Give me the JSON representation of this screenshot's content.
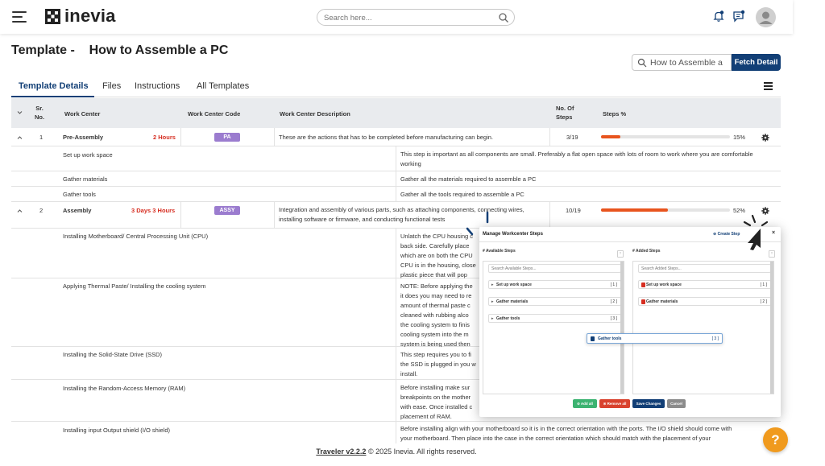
{
  "nav": {
    "brand": "inevia",
    "search_placeholder": "Search here..."
  },
  "header": {
    "title_prefix": "Template -",
    "title_name": "How to Assemble a PC",
    "template_search_value": "How to Assemble a",
    "fetch_label": "Fetch Detail"
  },
  "tabs": [
    {
      "label": "Template Details",
      "active": true
    },
    {
      "label": "Files",
      "active": false
    },
    {
      "label": "Instructions",
      "active": false
    },
    {
      "label": "All Templates",
      "active": false
    }
  ],
  "table": {
    "columns": {
      "sr": "Sr. No.",
      "center": "Work Center",
      "code": "Work Center Code",
      "desc": "Work Center Description",
      "steps_no": "No. Of Steps",
      "steps_pct": "Steps %"
    },
    "rows": [
      {
        "sr": "1",
        "center": "Pre-Assembly",
        "duration": "2 Hours",
        "code": "PA",
        "desc": "These are the actions that has to be completed before manufacturing can begin.",
        "steps": "3/19",
        "pct_label": "15%",
        "pct": 15,
        "substeps": [
          {
            "name": "Set up work space",
            "desc": "This step is important as all components are small. Preferably a flat open space with lots of room to work where you are comfortable working"
          },
          {
            "name": "Gather materials",
            "desc": "Gather all the materials required to assemble a PC"
          },
          {
            "name": "Gather tools",
            "desc": "Gather all the tools required to assemble a PC"
          }
        ]
      },
      {
        "sr": "2",
        "center": "Assembly",
        "duration": "3 Days 3 Hours",
        "code": "ASSY",
        "desc": "Integration and assembly of various parts, such as attaching components, connecting wires, installing software or firmware, and conducting functional tests",
        "steps": "10/19",
        "pct_label": "52%",
        "pct": 52,
        "substeps": [
          {
            "name": "Installing Motherboard/ Central Processing Unit (CPU)",
            "desc": "Unlatch the CPU housing c\nback side. Carefully place\nwhich are on both the CPU\nCPU is in the housing, close\nplastic piece that will pop"
          },
          {
            "name": "Applying Thermal Paste/ Installing the cooling system",
            "desc": "NOTE: Before applying the\nit does you may need to re\namount of thermal paste c\ncleaned with rubbing alco\nthe cooling system to finis\ncooling system into the m\nsystem is being used then"
          },
          {
            "name": "Installing the Solid-State Drive (SSD)",
            "desc": "This step requires you to fi\nthe SSD is plugged in you w\ninstall."
          },
          {
            "name": "Installing the Random-Access Memory (RAM)",
            "desc": "Before installing make sur\nbreakpoints on the mother\nwith ease. Once installed c\nplacement of RAM."
          },
          {
            "name": "Installing input Output shield (I/O shield)",
            "desc": "Before installing align with your motherboard so it is in the correct orientation with the ports. The I/O shield should come with\nyour motherboard. Then place into the case in the correct orientation which should match with the placement of your"
          }
        ]
      }
    ]
  },
  "modal": {
    "title": "Manage Workcenter Steps",
    "create_step": "Create Step",
    "close": "×",
    "available_title": "# Available Steps",
    "added_title": "# Added Steps",
    "available_placeholder": "Search Available Steps...",
    "added_placeholder": "Search Added Steps...",
    "sort_symbol": "↑",
    "available": [
      {
        "label": "Set up work space",
        "count": "[ 1 ]"
      },
      {
        "label": "Gather materials",
        "count": "[ 2 ]"
      },
      {
        "label": "Gather tools",
        "count": "[ 3 ]"
      }
    ],
    "added": [
      {
        "label": "Set up work space",
        "count": "[ 1 ]"
      },
      {
        "label": "Gather materials",
        "count": "[ 2 ]"
      }
    ],
    "dragging": {
      "label": "Gather tools",
      "count": "[ 3 ]"
    },
    "buttons": {
      "add_all": "Add all",
      "remove_all": "Remove all",
      "save": "Save Changes",
      "cancel": "Cancel"
    }
  },
  "footer": {
    "version": "Traveler v2.2.2",
    "copyright": "© 2025 Inevia. All rights reserved."
  },
  "help": "?",
  "colors": {
    "brand_navy": "#123f76",
    "progress": "#e8541e",
    "duration_red": "#d62d20",
    "badge_purple": "#9b7ccf",
    "help_orange": "#f09a1e",
    "add_green": "#3cb371",
    "remove_red": "#d9432f",
    "cancel_grey": "#8c8c8c"
  }
}
